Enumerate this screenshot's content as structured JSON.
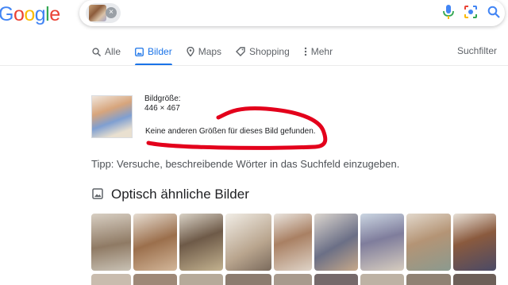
{
  "logo": {
    "text": "Google",
    "letters": [
      {
        "ch": "G",
        "color": "#4285f4"
      },
      {
        "ch": "o",
        "color": "#ea4335"
      },
      {
        "ch": "o",
        "color": "#fbbc05"
      },
      {
        "ch": "g",
        "color": "#4285f4"
      },
      {
        "ch": "l",
        "color": "#34a853"
      },
      {
        "ch": "e",
        "color": "#ea4335"
      }
    ]
  },
  "search": {
    "chip_close": "×",
    "icons": [
      "mic-icon",
      "camera-lens-icon",
      "search-icon"
    ]
  },
  "tabs": [
    {
      "label": "Alle",
      "icon": "search-icon",
      "active": false
    },
    {
      "label": "Bilder",
      "icon": "image-icon",
      "active": true
    },
    {
      "label": "Maps",
      "icon": "map-pin-icon",
      "active": false
    },
    {
      "label": "Shopping",
      "icon": "tag-icon",
      "active": false
    },
    {
      "label": "Mehr",
      "icon": "more-vertical-icon",
      "active": false
    }
  ],
  "filters_label": "Suchfilter",
  "result": {
    "size_label": "Bildgröße:",
    "size_value": "446 × 467",
    "no_other_sizes": "Keine anderen Größen für dieses Bild gefunden."
  },
  "tip": "Tipp: Versuche, beschreibende Wörter in das Suchfeld einzugeben.",
  "similar": {
    "title": "Optisch ähnliche Bilder",
    "icon": "image-icon"
  },
  "colors": {
    "accent": "#1a73e8",
    "annotation_red": "#e3001b",
    "text": "#202124",
    "muted": "#5f6368"
  }
}
